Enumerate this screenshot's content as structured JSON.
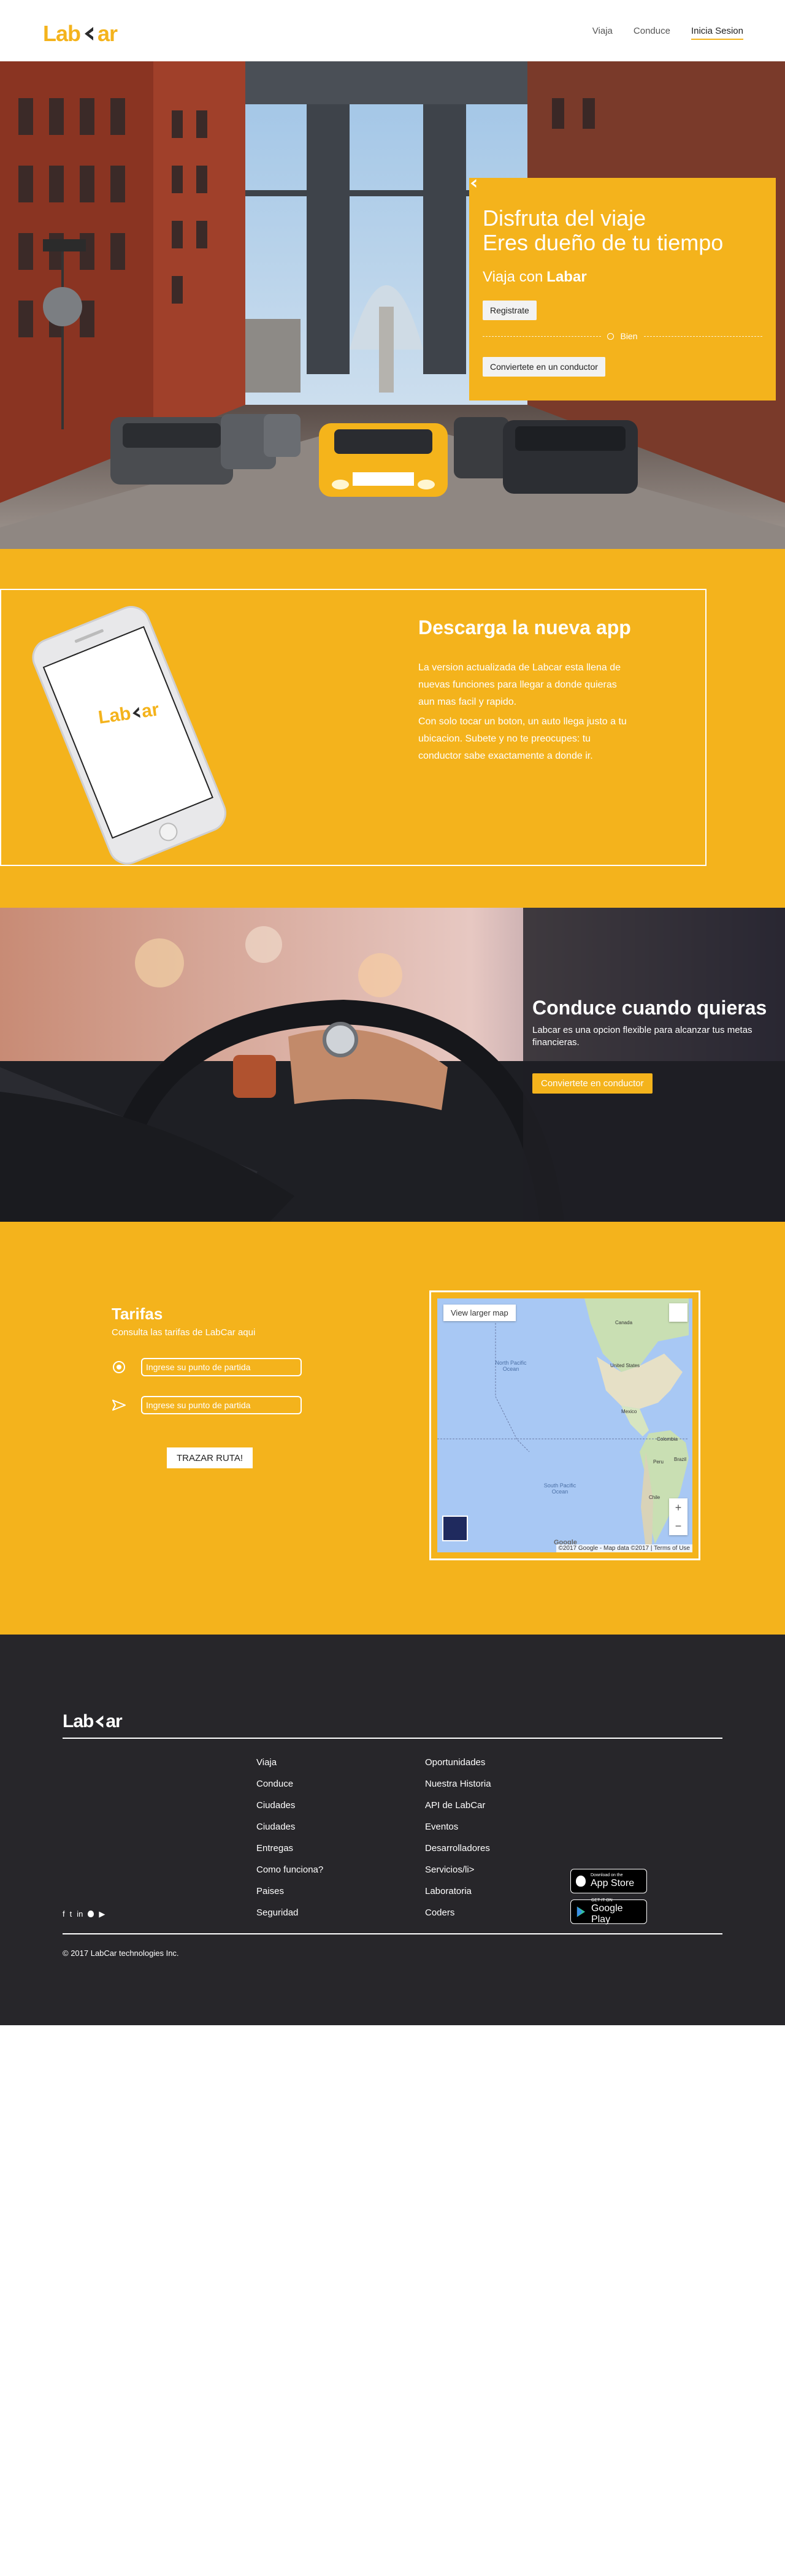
{
  "header": {
    "logo_left": "Lab",
    "logo_right": "ar",
    "nav": [
      "Viaja",
      "Conduce",
      "Inicia Sesion"
    ]
  },
  "hero": {
    "title_line1": "Disfruta del viaje",
    "title_line2": "Eres dueño de tu tiempo",
    "subtitle_prefix": "Viaja con",
    "subtitle_logo_left": "Lab",
    "subtitle_logo_right": "ar",
    "register_button": "Registrate",
    "divider_text": "Bien",
    "driver_button": "Conviertete en un conductor"
  },
  "app_section": {
    "phone_logo_left": "Lab",
    "phone_logo_right": "ar",
    "title": "Descarga la nueva app",
    "paragraph1": "La version actualizada de Labcar esta llena de nuevas funciones para llegar a donde quieras aun mas facil y rapido.",
    "paragraph2": "Con solo tocar un boton, un auto llega justo a tu ubicacion. Subete y no te preocupes: tu conductor sabe exactamente a donde ir."
  },
  "driver_section": {
    "title": "Conduce cuando quieras",
    "text": "Labcar es una opcion flexible para alcanzar tus metas financieras.",
    "button": "Conviertete en conductor"
  },
  "rates": {
    "title": "Tarifas",
    "subtitle": "Consulta las tarifas de LabCar aqui",
    "origin_placeholder": "Ingrese su punto de partida",
    "destination_placeholder": "Ingrese su punto de partida",
    "trace_button": "TRAZAR RUTA!",
    "map": {
      "larger_link": "View larger map",
      "north_ocean": "North Pacific Ocean",
      "south_ocean": "South Pacific Ocean",
      "canada": "Canada",
      "usa": "United States",
      "mexico": "Mexico",
      "colombia": "Colombia",
      "peru": "Peru",
      "brazil": "Brazil",
      "chile": "Chile",
      "zoom_in": "+",
      "zoom_out": "−",
      "google": "Google",
      "attribution": "©2017 Google - Map data ©2017 | Terms of Use"
    }
  },
  "footer": {
    "logo_left": "Lab",
    "logo_right": "ar",
    "col1": [
      "Viaja",
      "Conduce",
      "Ciudades",
      "Ciudades",
      "Entregas",
      "Como funciona?",
      "Paises",
      "Seguridad"
    ],
    "col2": [
      "Oportunidades",
      "Nuestra Historia",
      "API de LabCar",
      "Eventos",
      "Desarrolladores",
      "Servicios/li>",
      "Laboratoria",
      "Coders"
    ],
    "social": [
      "f",
      "t",
      "in",
      "",
      "▶"
    ],
    "app_store_small": "Download on the",
    "app_store_big": "App Store",
    "play_small": "GET IT ON",
    "play_big": "Google Play",
    "copyright": "© 2017 LabCar technologies Inc."
  },
  "colors": {
    "brand": "#f4b31c",
    "footer_bg": "#27262a"
  }
}
